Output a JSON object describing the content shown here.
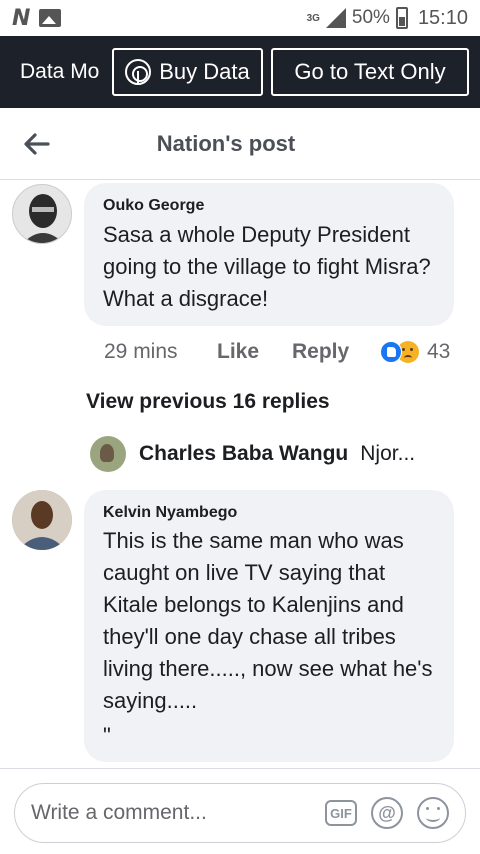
{
  "status_bar": {
    "network": "3G",
    "battery": "50%",
    "time": "15:10"
  },
  "data_bar": {
    "mode_label": "Data Mo",
    "buy_data": "Buy Data",
    "text_only": "Go to Text Only"
  },
  "header": {
    "title": "Nation's post"
  },
  "comments": [
    {
      "author": "Ouko George",
      "text": "Sasa a whole Deputy President going to the village to fight Misra? What a disgrace!",
      "time": "29 mins",
      "like": "Like",
      "reply": "Reply",
      "reaction_count": "43"
    },
    {
      "author": "Kelvin Nyambego",
      "text": "This is the same man who was caught on live TV saying that Kitale belongs to Kalenjins and they'll one day chase all tribes living there....., now see what he's saying.....",
      "trailing": "\""
    }
  ],
  "view_previous": "View previous 16 replies",
  "reply_preview": {
    "name": "Charles Baba Wangu",
    "snippet": "Njor..."
  },
  "composer": {
    "placeholder": "Write a comment...",
    "gif_label": "GIF",
    "at_label": "@"
  }
}
